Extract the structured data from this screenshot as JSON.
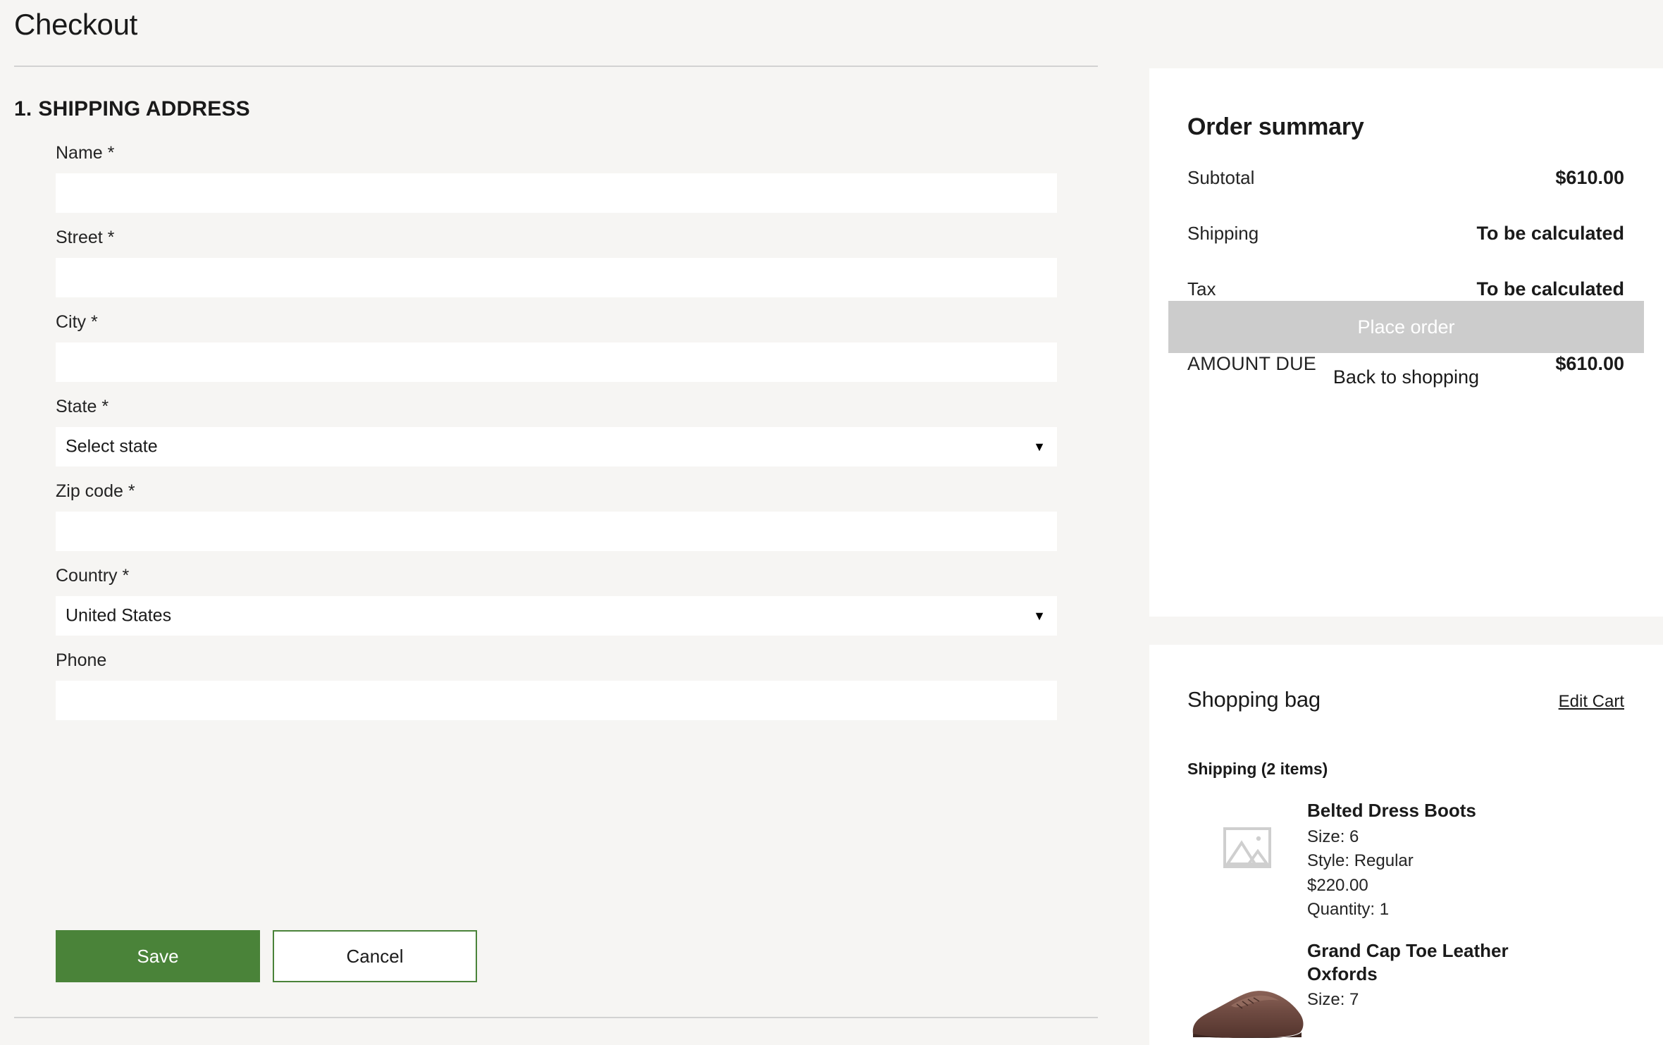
{
  "page": {
    "title": "Checkout",
    "background_color": "#f6f5f3"
  },
  "shipping_section": {
    "step_number": "1.",
    "heading": "SHIPPING ADDRESS",
    "fields": [
      {
        "label": "Name *",
        "type": "text",
        "value": "",
        "placeholder": ""
      },
      {
        "label": "Street *",
        "type": "text",
        "value": "",
        "placeholder": ""
      },
      {
        "label": "City *",
        "type": "text",
        "value": "",
        "placeholder": ""
      },
      {
        "label": "State *",
        "type": "select",
        "value": "Select state",
        "caret": "▼"
      },
      {
        "label": "Zip code *",
        "type": "text",
        "value": "",
        "placeholder": ""
      },
      {
        "label": "Country *",
        "type": "select",
        "value": "United States",
        "caret": "▼"
      },
      {
        "label": "Phone",
        "type": "text",
        "value": "",
        "placeholder": ""
      }
    ],
    "save_label": "Save",
    "cancel_label": "Cancel",
    "save_color": "#4a8339"
  },
  "order_summary": {
    "title": "Order summary",
    "rows": [
      {
        "label": "Subtotal",
        "value": "$610.00"
      },
      {
        "label": "Shipping",
        "value": "To be calculated"
      },
      {
        "label": "Tax",
        "value": "To be calculated"
      }
    ],
    "total": {
      "label": "AMOUNT DUE",
      "value": "$610.00"
    },
    "place_order_label": "Place order",
    "place_order_disabled_color": "#cccccc",
    "back_to_shopping_label": "Back to shopping"
  },
  "shopping_bag": {
    "title": "Shopping bag",
    "edit_cart_label": "Edit Cart",
    "group_label": "Shipping (2 items)",
    "items": [
      {
        "name": "Belted Dress Boots",
        "size": "Size: 6",
        "style": "Style: Regular",
        "price": "$220.00",
        "quantity": "Quantity: 1",
        "thumb": "image-placeholder-icon"
      },
      {
        "name": "Grand Cap Toe Leather Oxfords",
        "size": "Size: 7",
        "thumb": "brown-oxford-shoe-photo"
      }
    ]
  }
}
